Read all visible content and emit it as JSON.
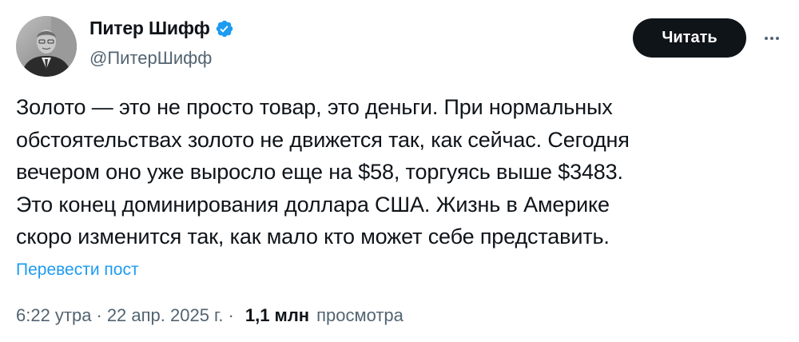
{
  "author": {
    "name": "Питер Шифф",
    "handle": "@ПитерШифф",
    "verified_color": "#1d9bf0"
  },
  "actions": {
    "follow_label": "Читать",
    "more_icon": "more-dots-icon"
  },
  "tweet": {
    "lines": [
      "Золото — это не просто товар, это деньги. При нормальных",
      "обстоятельствах золото не движется так, как сейчас. Сегодня",
      "вечером оно уже выросло еще на $58, торгуясь выше $3483.",
      "Это конец доминирования доллара США. Жизнь в Америке",
      "скоро изменится так, как мало кто может себе представить."
    ],
    "translate_label": "Перевести пост"
  },
  "meta": {
    "time": "6:22 утра",
    "separator": "·",
    "date": "22 апр. 2025 г.",
    "views_count": "1,1 млн",
    "views_label": "просмотра"
  },
  "colors": {
    "accent": "#1d9bf0",
    "text": "#0f1419",
    "secondary": "#536471",
    "button_bg": "#0f1419"
  }
}
